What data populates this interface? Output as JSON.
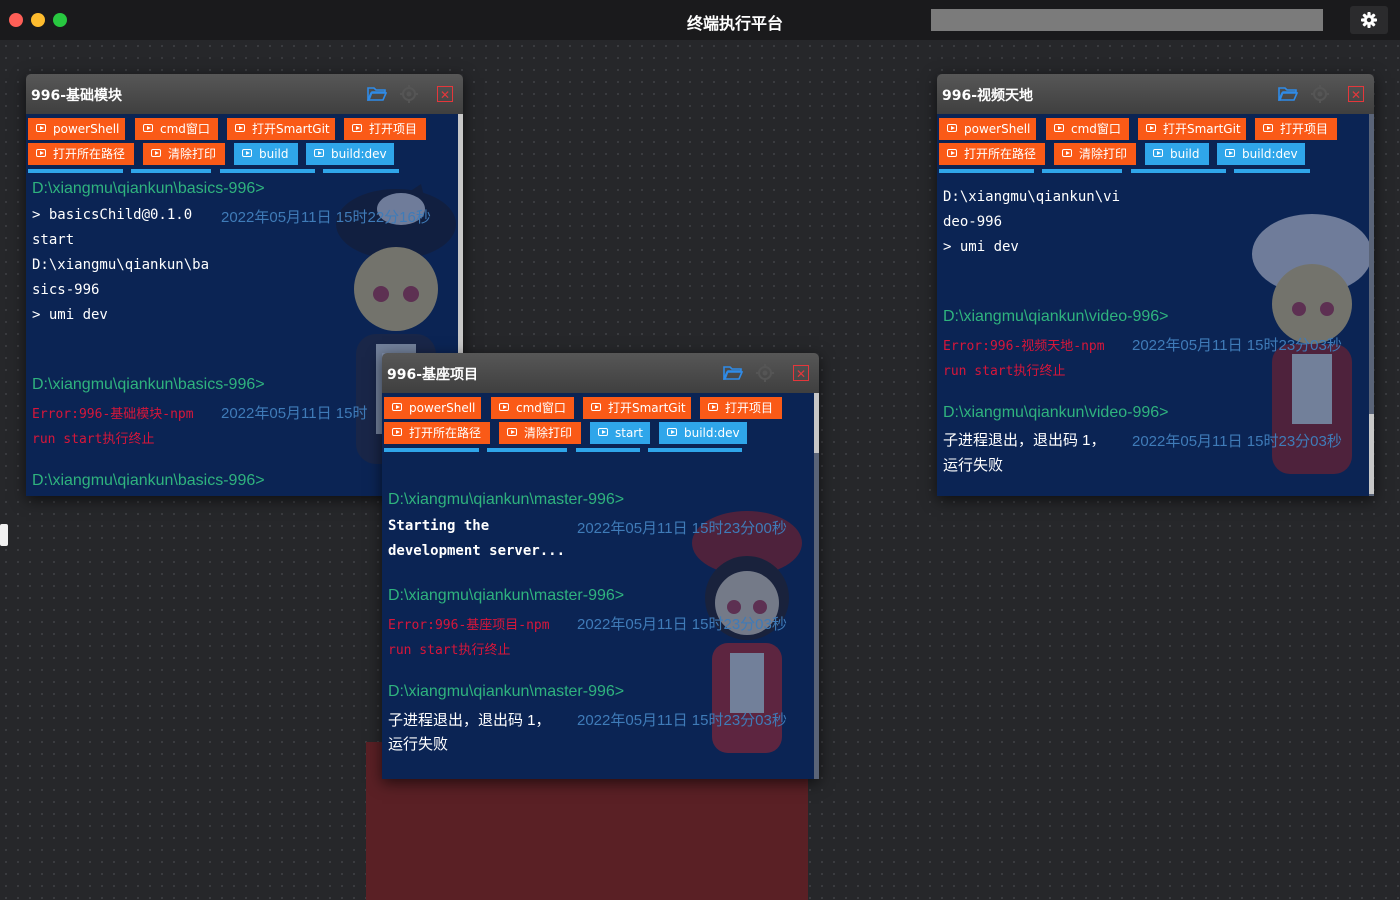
{
  "app": {
    "title": "终端执行平台",
    "search_value": ""
  },
  "icons": {
    "settings": "gear-icon",
    "folder": "folder-open-icon",
    "locate": "crosshair-icon",
    "close": "close-icon",
    "play": "play-circle-icon"
  },
  "colors": {
    "orange_button": "#fa5a17",
    "blue_button": "#2fa6ea",
    "terminal_bg": "#0b2454",
    "path_text": "#2fb37e",
    "error_text": "#d7163a",
    "timestamp_text": "#3f7bb8"
  },
  "panels": {
    "basics": {
      "title": "996-基础模块",
      "row1": [
        "powerShell",
        "cmd窗口",
        "打开SmartGit",
        "打开项目"
      ],
      "row2": [
        "打开所在路径",
        "清除打印",
        "build",
        "build:dev"
      ],
      "lines": {
        "l1": "D:\\xiangmu\\qiankun\\basics-996>",
        "l2": "> basicsChild@0.1.0",
        "l2_ts": "2022年05月11日 15时22分16秒",
        "l3": "start",
        "l4": "D:\\xiangmu\\qiankun\\ba",
        "l5": "sics-996",
        "l6": "> umi dev",
        "l7": "D:\\xiangmu\\qiankun\\basics-996>",
        "l8": "Error:996-基础模块-npm",
        "l8_ts": "2022年05月11日 15时",
        "l9": "run start执行终止",
        "l10": "D:\\xiangmu\\qiankun\\basics-996>"
      }
    },
    "master": {
      "title": "996-基座项目",
      "row1": [
        "powerShell",
        "cmd窗口",
        "打开SmartGit",
        "打开项目"
      ],
      "row2": [
        "打开所在路径",
        "清除打印",
        "start",
        "build:dev"
      ],
      "lines": {
        "l1": "D:\\xiangmu\\qiankun\\master-996>",
        "l2": "Starting the",
        "l2_ts": "2022年05月11日 15时23分00秒",
        "l3": "development server...",
        "l4": "D:\\xiangmu\\qiankun\\master-996>",
        "l5": "Error:996-基座项目-npm",
        "l5_ts": "2022年05月11日 15时23分03秒",
        "l6": "run start执行终止",
        "l7": "D:\\xiangmu\\qiankun\\master-996>",
        "l8": "子进程退出，退出码 1，",
        "l8_ts": "2022年05月11日 15时23分03秒",
        "l9": "运行失败"
      }
    },
    "video": {
      "title": "996-视频天地",
      "row1": [
        "powerShell",
        "cmd窗口",
        "打开SmartGit",
        "打开项目"
      ],
      "row2": [
        "打开所在路径",
        "清除打印",
        "build",
        "build:dev"
      ],
      "lines": {
        "l1": "D:\\xiangmu\\qiankun\\vi",
        "l2": "deo-996",
        "l3": "> umi dev",
        "l4": "D:\\xiangmu\\qiankun\\video-996>",
        "l5": "Error:996-视频天地-npm",
        "l5_ts": "2022年05月11日 15时23分03秒",
        "l6": "run start执行终止",
        "l7": "D:\\xiangmu\\qiankun\\video-996>",
        "l8": "子进程退出，退出码 1，",
        "l8_ts": "2022年05月11日 15时23分03秒",
        "l9": "运行失败"
      }
    }
  }
}
